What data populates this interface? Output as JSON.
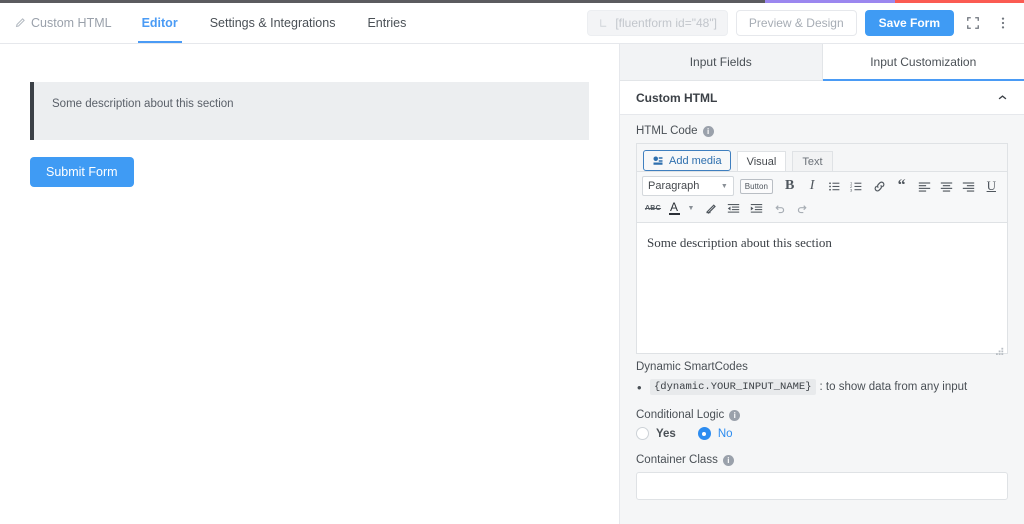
{
  "top_strip": {
    "colors": [
      "#5b5b5f",
      "#9b87ef",
      "#fb5b52"
    ]
  },
  "topbar": {
    "form_name": "Custom HTML",
    "pencil_icon": "pencil-icon",
    "tabs": [
      {
        "label": "Editor",
        "active": true
      },
      {
        "label": "Settings & Integrations",
        "active": false
      },
      {
        "label": "Entries",
        "active": false
      }
    ],
    "shortcode": {
      "value": "[fluentform id=\"48\"]",
      "copy_icon": "copy-icon"
    },
    "preview_label": "Preview & Design",
    "save_label": "Save Form",
    "fullscreen_icon": "fullscreen-icon",
    "more_icon": "more-vertical-icon",
    "accent_color": "#3f9bf4"
  },
  "canvas": {
    "description_text": "Some description about this section",
    "submit_label": "Submit Form",
    "accent_color": "#3f9bf4",
    "block_bg": "#eceef0",
    "block_border": "#3b4046"
  },
  "panel": {
    "tabs": [
      {
        "label": "Input Fields",
        "active": false
      },
      {
        "label": "Input Customization",
        "active": true
      }
    ],
    "section_title": "Custom HTML",
    "collapse_icon": "chevron-up-icon",
    "html_code": {
      "label": "HTML Code",
      "info_icon": "info-icon",
      "add_media_label": "Add media",
      "media_icon": "add-media-icon",
      "editor_tabs": [
        {
          "label": "Visual",
          "active": true
        },
        {
          "label": "Text",
          "active": false
        }
      ],
      "toolbar_row1": [
        {
          "name": "format-select",
          "label": "Paragraph",
          "type": "select"
        },
        {
          "name": "button-shortcode",
          "label": "Button",
          "type": "tag"
        },
        {
          "name": "bold-icon",
          "label": "B",
          "type": "bold"
        },
        {
          "name": "italic-icon",
          "label": "I",
          "type": "italic"
        },
        {
          "name": "bullet-list-icon",
          "label": "",
          "type": "ul"
        },
        {
          "name": "numbered-list-icon",
          "label": "",
          "type": "ol"
        },
        {
          "name": "link-icon",
          "label": "",
          "type": "link"
        },
        {
          "name": "blockquote-icon",
          "label": "“",
          "type": "quote"
        },
        {
          "name": "align-left-icon",
          "label": "",
          "type": "alignleft"
        },
        {
          "name": "align-center-icon",
          "label": "",
          "type": "aligncenter"
        },
        {
          "name": "align-right-icon",
          "label": "",
          "type": "alignright"
        },
        {
          "name": "underline-icon",
          "label": "U",
          "type": "underline"
        }
      ],
      "toolbar_row2": [
        {
          "name": "strikethrough-icon",
          "label": "ABC",
          "type": "strike"
        },
        {
          "name": "text-color-icon",
          "label": "A",
          "type": "color"
        },
        {
          "name": "clear-formatting-icon",
          "label": "",
          "type": "eraser"
        },
        {
          "name": "decrease-indent-icon",
          "label": "",
          "type": "outdent"
        },
        {
          "name": "increase-indent-icon",
          "label": "",
          "type": "indent"
        },
        {
          "name": "undo-icon",
          "label": "",
          "type": "undo"
        },
        {
          "name": "redo-icon",
          "label": "",
          "type": "redo"
        }
      ],
      "content_text": "Some description about this section"
    },
    "smartcodes": {
      "title": "Dynamic SmartCodes",
      "items": [
        {
          "code": "{dynamic.YOUR_INPUT_NAME}",
          "description": ": to show data from any input"
        }
      ]
    },
    "conditional_logic": {
      "label": "Conditional Logic",
      "info_icon": "info-icon",
      "options": [
        {
          "label": "Yes",
          "selected": false
        },
        {
          "label": "No",
          "selected": true
        }
      ],
      "selected_color": "#2d8cf0"
    },
    "container_class": {
      "label": "Container Class",
      "info_icon": "info-icon",
      "value": "",
      "placeholder": ""
    }
  }
}
